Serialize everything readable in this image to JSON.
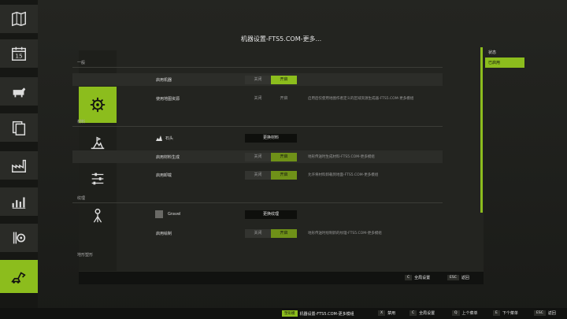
{
  "colors": {
    "accent": "#8cbd1d",
    "background": "#1c1d1a",
    "panel": "#232420"
  },
  "sidebar": {
    "items": [
      {
        "icon": "map-icon"
      },
      {
        "icon": "calendar-icon",
        "label": "15"
      },
      {
        "icon": "livestock-icon"
      },
      {
        "icon": "documents-icon"
      },
      {
        "icon": "production-icon"
      },
      {
        "icon": "statistics-icon"
      },
      {
        "icon": "settings-gears-icon"
      },
      {
        "icon": "construction-icon"
      }
    ]
  },
  "dialog": {
    "title": "机器设置-FTS5.COM-更多..."
  },
  "tabs": [
    {
      "icon": "gear-icon"
    },
    {
      "icon": "terraform-icon"
    },
    {
      "icon": "sliders-icon"
    },
    {
      "icon": "survey-icon"
    }
  ],
  "sections": {
    "general": {
      "title": "一般",
      "enable_machine": {
        "label": "启用机器",
        "off": "关闭",
        "on": "开启"
      },
      "use_map_resources": {
        "label": "使用地图资源",
        "off": "关闭",
        "on": "开启",
        "desc": "启用后仅使用地图作者定义的区域资源生成器-FTS5.COM-更多模组"
      }
    },
    "material": {
      "title": "材料",
      "stone": {
        "label": "石头",
        "button": "更换材料"
      },
      "enable_material_gen": {
        "label": "启用材料生成",
        "off": "关闭",
        "on": "开启",
        "desc": "地形传送时生成材料-FTS5.COM-更多模组"
      },
      "enable_discharge": {
        "label": "启用卸载",
        "off": "关闭",
        "on": "开启",
        "desc": "允许将材料卸载到地面-FTS5.COM-更多模组"
      }
    },
    "texture": {
      "title": "纹理",
      "gravel": {
        "label": "Gravel",
        "button": "更换纹理"
      },
      "enable_paint": {
        "label": "启用绘制",
        "off": "关闭",
        "on": "开启",
        "desc": "地形传送时绘制新的纹理-FTS5.COM-更多模组"
      }
    },
    "terrain": {
      "title": "地形塑形"
    }
  },
  "right_panel": {
    "items": [
      "状态",
      "已启用"
    ]
  },
  "dialog_footer": {
    "c_key": "C",
    "c_label": "全局设置",
    "esc_key": "ESC",
    "esc_label": "返回"
  },
  "bottom_bar": {
    "brand": "塑形模",
    "title": "机器设置-FTS5.COM-更多模组",
    "x_key": "X",
    "x_label": "禁用",
    "c_key": "C",
    "c_label": "全局设置",
    "q_key": "Q",
    "q_label": "上个菜单",
    "e_key": "E",
    "e_label": "下个菜单",
    "esc_key": "ESC",
    "esc_label": "返回"
  }
}
